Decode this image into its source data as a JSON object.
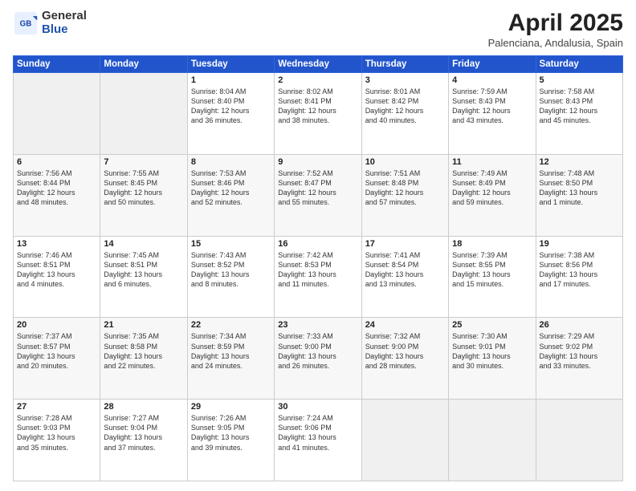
{
  "header": {
    "logo_general": "General",
    "logo_blue": "Blue",
    "title": "April 2025",
    "location": "Palenciana, Andalusia, Spain"
  },
  "weekdays": [
    "Sunday",
    "Monday",
    "Tuesday",
    "Wednesday",
    "Thursday",
    "Friday",
    "Saturday"
  ],
  "weeks": [
    [
      {
        "num": "",
        "info": ""
      },
      {
        "num": "",
        "info": ""
      },
      {
        "num": "1",
        "info": "Sunrise: 8:04 AM\nSunset: 8:40 PM\nDaylight: 12 hours\nand 36 minutes."
      },
      {
        "num": "2",
        "info": "Sunrise: 8:02 AM\nSunset: 8:41 PM\nDaylight: 12 hours\nand 38 minutes."
      },
      {
        "num": "3",
        "info": "Sunrise: 8:01 AM\nSunset: 8:42 PM\nDaylight: 12 hours\nand 40 minutes."
      },
      {
        "num": "4",
        "info": "Sunrise: 7:59 AM\nSunset: 8:43 PM\nDaylight: 12 hours\nand 43 minutes."
      },
      {
        "num": "5",
        "info": "Sunrise: 7:58 AM\nSunset: 8:43 PM\nDaylight: 12 hours\nand 45 minutes."
      }
    ],
    [
      {
        "num": "6",
        "info": "Sunrise: 7:56 AM\nSunset: 8:44 PM\nDaylight: 12 hours\nand 48 minutes."
      },
      {
        "num": "7",
        "info": "Sunrise: 7:55 AM\nSunset: 8:45 PM\nDaylight: 12 hours\nand 50 minutes."
      },
      {
        "num": "8",
        "info": "Sunrise: 7:53 AM\nSunset: 8:46 PM\nDaylight: 12 hours\nand 52 minutes."
      },
      {
        "num": "9",
        "info": "Sunrise: 7:52 AM\nSunset: 8:47 PM\nDaylight: 12 hours\nand 55 minutes."
      },
      {
        "num": "10",
        "info": "Sunrise: 7:51 AM\nSunset: 8:48 PM\nDaylight: 12 hours\nand 57 minutes."
      },
      {
        "num": "11",
        "info": "Sunrise: 7:49 AM\nSunset: 8:49 PM\nDaylight: 12 hours\nand 59 minutes."
      },
      {
        "num": "12",
        "info": "Sunrise: 7:48 AM\nSunset: 8:50 PM\nDaylight: 13 hours\nand 1 minute."
      }
    ],
    [
      {
        "num": "13",
        "info": "Sunrise: 7:46 AM\nSunset: 8:51 PM\nDaylight: 13 hours\nand 4 minutes."
      },
      {
        "num": "14",
        "info": "Sunrise: 7:45 AM\nSunset: 8:51 PM\nDaylight: 13 hours\nand 6 minutes."
      },
      {
        "num": "15",
        "info": "Sunrise: 7:43 AM\nSunset: 8:52 PM\nDaylight: 13 hours\nand 8 minutes."
      },
      {
        "num": "16",
        "info": "Sunrise: 7:42 AM\nSunset: 8:53 PM\nDaylight: 13 hours\nand 11 minutes."
      },
      {
        "num": "17",
        "info": "Sunrise: 7:41 AM\nSunset: 8:54 PM\nDaylight: 13 hours\nand 13 minutes."
      },
      {
        "num": "18",
        "info": "Sunrise: 7:39 AM\nSunset: 8:55 PM\nDaylight: 13 hours\nand 15 minutes."
      },
      {
        "num": "19",
        "info": "Sunrise: 7:38 AM\nSunset: 8:56 PM\nDaylight: 13 hours\nand 17 minutes."
      }
    ],
    [
      {
        "num": "20",
        "info": "Sunrise: 7:37 AM\nSunset: 8:57 PM\nDaylight: 13 hours\nand 20 minutes."
      },
      {
        "num": "21",
        "info": "Sunrise: 7:35 AM\nSunset: 8:58 PM\nDaylight: 13 hours\nand 22 minutes."
      },
      {
        "num": "22",
        "info": "Sunrise: 7:34 AM\nSunset: 8:59 PM\nDaylight: 13 hours\nand 24 minutes."
      },
      {
        "num": "23",
        "info": "Sunrise: 7:33 AM\nSunset: 9:00 PM\nDaylight: 13 hours\nand 26 minutes."
      },
      {
        "num": "24",
        "info": "Sunrise: 7:32 AM\nSunset: 9:00 PM\nDaylight: 13 hours\nand 28 minutes."
      },
      {
        "num": "25",
        "info": "Sunrise: 7:30 AM\nSunset: 9:01 PM\nDaylight: 13 hours\nand 30 minutes."
      },
      {
        "num": "26",
        "info": "Sunrise: 7:29 AM\nSunset: 9:02 PM\nDaylight: 13 hours\nand 33 minutes."
      }
    ],
    [
      {
        "num": "27",
        "info": "Sunrise: 7:28 AM\nSunset: 9:03 PM\nDaylight: 13 hours\nand 35 minutes."
      },
      {
        "num": "28",
        "info": "Sunrise: 7:27 AM\nSunset: 9:04 PM\nDaylight: 13 hours\nand 37 minutes."
      },
      {
        "num": "29",
        "info": "Sunrise: 7:26 AM\nSunset: 9:05 PM\nDaylight: 13 hours\nand 39 minutes."
      },
      {
        "num": "30",
        "info": "Sunrise: 7:24 AM\nSunset: 9:06 PM\nDaylight: 13 hours\nand 41 minutes."
      },
      {
        "num": "",
        "info": ""
      },
      {
        "num": "",
        "info": ""
      },
      {
        "num": "",
        "info": ""
      }
    ]
  ]
}
